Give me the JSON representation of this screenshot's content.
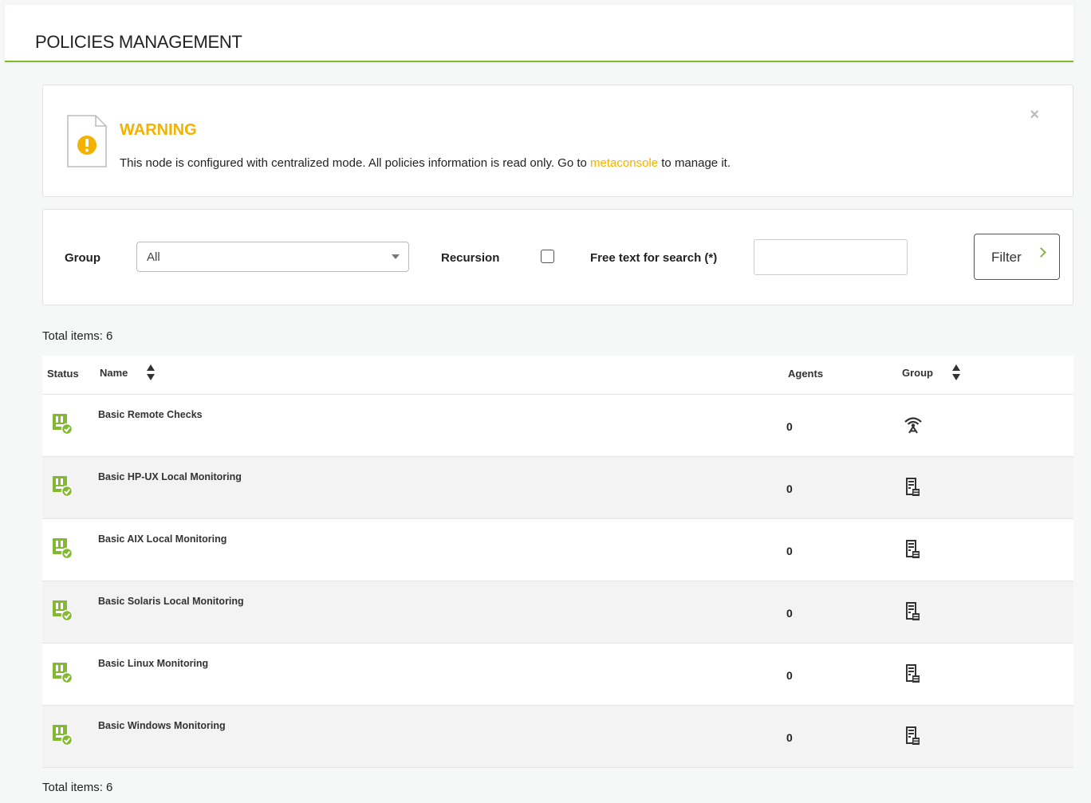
{
  "header": {
    "title": "POLICIES MANAGEMENT"
  },
  "warning": {
    "title": "WARNING",
    "text_before": "This node is configured with centralized mode. All policies information is read only. Go to ",
    "link_text": "metaconsole",
    "text_after": " to manage it.",
    "close_label": "×",
    "accent_color": "#f3b200"
  },
  "filter": {
    "group_label": "Group",
    "group_value": "All",
    "recursion_label": "Recursion",
    "recursion_checked": false,
    "search_label": "Free text for search (*)",
    "search_value": "",
    "button_label": "Filter"
  },
  "total_top": "Total items: 6",
  "total_bottom": "Total items: 6",
  "table": {
    "columns": {
      "status": "Status",
      "name": "Name",
      "agents": "Agents",
      "group": "Group"
    },
    "rows": [
      {
        "status_icon": "policy-ok-icon",
        "name": "Basic Remote Checks",
        "agents": "0",
        "group_icon": "antenna-icon"
      },
      {
        "status_icon": "policy-ok-icon",
        "name": "Basic HP-UX Local Monitoring",
        "agents": "0",
        "group_icon": "server-icon"
      },
      {
        "status_icon": "policy-ok-icon",
        "name": "Basic AIX Local Monitoring",
        "agents": "0",
        "group_icon": "server-icon"
      },
      {
        "status_icon": "policy-ok-icon",
        "name": "Basic Solaris Local Monitoring",
        "agents": "0",
        "group_icon": "server-icon"
      },
      {
        "status_icon": "policy-ok-icon",
        "name": "Basic Linux Monitoring",
        "agents": "0",
        "group_icon": "server-icon"
      },
      {
        "status_icon": "policy-ok-icon",
        "name": "Basic Windows Monitoring",
        "agents": "0",
        "group_icon": "server-icon"
      }
    ]
  },
  "colors": {
    "accent": "#82b92e",
    "warning": "#f3b200"
  }
}
